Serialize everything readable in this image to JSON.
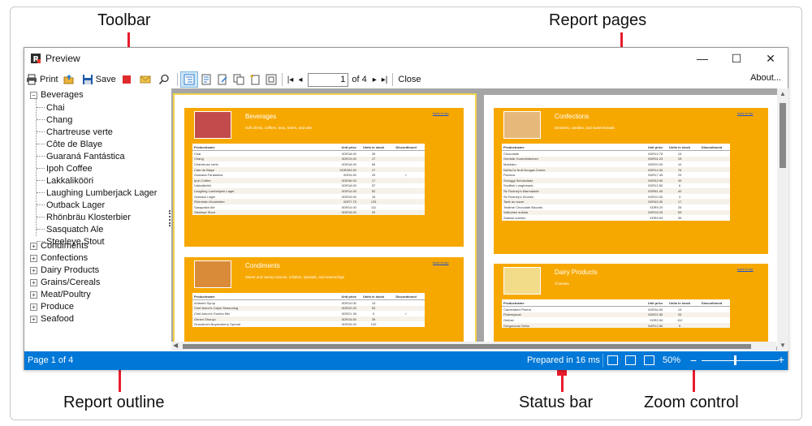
{
  "callouts": {
    "toolbar": "Toolbar",
    "report_pages": "Report pages",
    "report_outline": "Report outline",
    "status_bar": "Status bar",
    "zoom_control": "Zoom control"
  },
  "window": {
    "title": "Preview",
    "min": "—",
    "max": "☐",
    "close": "✕"
  },
  "toolbar": {
    "print_label": "Print",
    "save_label": "Save",
    "page_value": "1",
    "page_of": "of 4",
    "close_label": "Close",
    "about_label": "About...",
    "first_glyph": "|◂",
    "prev_glyph": "◂",
    "next_glyph": "▸",
    "last_glyph": "▸|"
  },
  "outline": {
    "root": "Beverages",
    "children": [
      "Chai",
      "Chang",
      "Chartreuse verte",
      "Côte de Blaye",
      "Guaraná Fantástica",
      "Ipoh Coffee",
      "Lakkalikööri",
      "Laughing Lumberjack Lager",
      "Outback Lager",
      "Rhönbräu Klosterbier",
      "Sasquatch Ale",
      "Steeleye Stout"
    ],
    "collapsed": [
      "Condiments",
      "Confections",
      "Dairy Products",
      "Grains/Cereals",
      "Meat/Poultry",
      "Produce",
      "Seafood"
    ]
  },
  "report": {
    "backtop": "back to top",
    "headers": [
      "Productname",
      "Unit price",
      "Units in stock",
      "Discontinued"
    ],
    "sections": [
      {
        "title": "Beverages",
        "subtitle": "Soft drinks, coffees, teas, beers, and ales",
        "rows": [
          [
            "Chai",
            "XDR18.00",
            "39",
            ""
          ],
          [
            "Chang",
            "XDR19.00",
            "17",
            ""
          ],
          [
            "Chartreuse verte",
            "XDR18.00",
            "69",
            ""
          ],
          [
            "Côte de Blaye",
            "XDR263.50",
            "17",
            ""
          ],
          [
            "Guaraná Fantástica",
            "XDR4.50",
            "20",
            "✓"
          ],
          [
            "Ipoh Coffee",
            "XDR46.00",
            "17",
            ""
          ],
          [
            "Lakkalikööri",
            "XDR18.00",
            "57",
            ""
          ],
          [
            "Laughing Lumberjack Lager",
            "XDR14.00",
            "52",
            ""
          ],
          [
            "Outback Lager",
            "XDR15.00",
            "15",
            ""
          ],
          [
            "Rhönbräu Klosterbier",
            "XDR7.75",
            "125",
            ""
          ],
          [
            "Sasquatch Ale",
            "XDR14.00",
            "111",
            ""
          ],
          [
            "Steeleye Stout",
            "XDR18.00",
            "20",
            ""
          ]
        ]
      },
      {
        "title": "Condiments",
        "subtitle": "Sweet and savory sauces, relishes, spreads, and seasonings",
        "rows": [
          [
            "Aniseed Syrup",
            "XDR10.00",
            "13",
            ""
          ],
          [
            "Chef Anton's Cajun Seasoning",
            "XDR22.00",
            "53",
            ""
          ],
          [
            "Chef Anton's Gumbo Mix",
            "XDR21.35",
            "0",
            "✓"
          ],
          [
            "Genen Shouyu",
            "XDR15.50",
            "39",
            ""
          ],
          [
            "Grandma's Boysenberry Spread",
            "XDR25.00",
            "120",
            ""
          ]
        ]
      },
      {
        "title": "Confections",
        "subtitle": "Desserts, candies, and sweet breads",
        "rows": [
          [
            "Chocolade",
            "XDR12.75",
            "15",
            ""
          ],
          [
            "Gumbär Gummibärchen",
            "XDR31.23",
            "15",
            ""
          ],
          [
            "Maxilaku",
            "XDR20.00",
            "10",
            ""
          ],
          [
            "NuNuCa Nuß-Nougat-Creme",
            "XDR14.00",
            "76",
            ""
          ],
          [
            "Pavlova",
            "XDR17.45",
            "29",
            ""
          ],
          [
            "Schoggi Schokolade",
            "XDR43.90",
            "49",
            ""
          ],
          [
            "Scottish Longbreads",
            "XDR12.50",
            "6",
            ""
          ],
          [
            "Sir Rodney's Marmalade",
            "XDR81.00",
            "40",
            ""
          ],
          [
            "Sir Rodney's Scones",
            "XDR10.00",
            "3",
            ""
          ],
          [
            "Tarte au sucre",
            "XDR49.30",
            "17",
            ""
          ],
          [
            "Teatime Chocolate Biscuits",
            "XDR9.20",
            "25",
            ""
          ],
          [
            "Valkoinen suklaa",
            "XDR16.25",
            "65",
            ""
          ],
          [
            "Zaanse koeken",
            "XDR9.50",
            "36",
            ""
          ]
        ]
      },
      {
        "title": "Dairy Products",
        "subtitle": "Cheeses",
        "rows": [
          [
            "Camembert Pierrot",
            "XDR34.00",
            "19",
            ""
          ],
          [
            "Flotemysost",
            "XDR21.50",
            "26",
            ""
          ],
          [
            "Geitost",
            "XDR2.50",
            "112",
            ""
          ],
          [
            "Gorgonzola Telino",
            "XDR12.50",
            "0",
            ""
          ]
        ]
      }
    ]
  },
  "status": {
    "page": "Page 1 of 4",
    "prepared": "Prepared in 16 ms",
    "zoom": "50%",
    "zoom_minus": "−",
    "zoom_plus": "+",
    "zoom_level_fraction": 0.42
  },
  "colors": {
    "statusbar": "#0078d7",
    "band": "#f7a800",
    "callout_line": "#e81c2c"
  }
}
